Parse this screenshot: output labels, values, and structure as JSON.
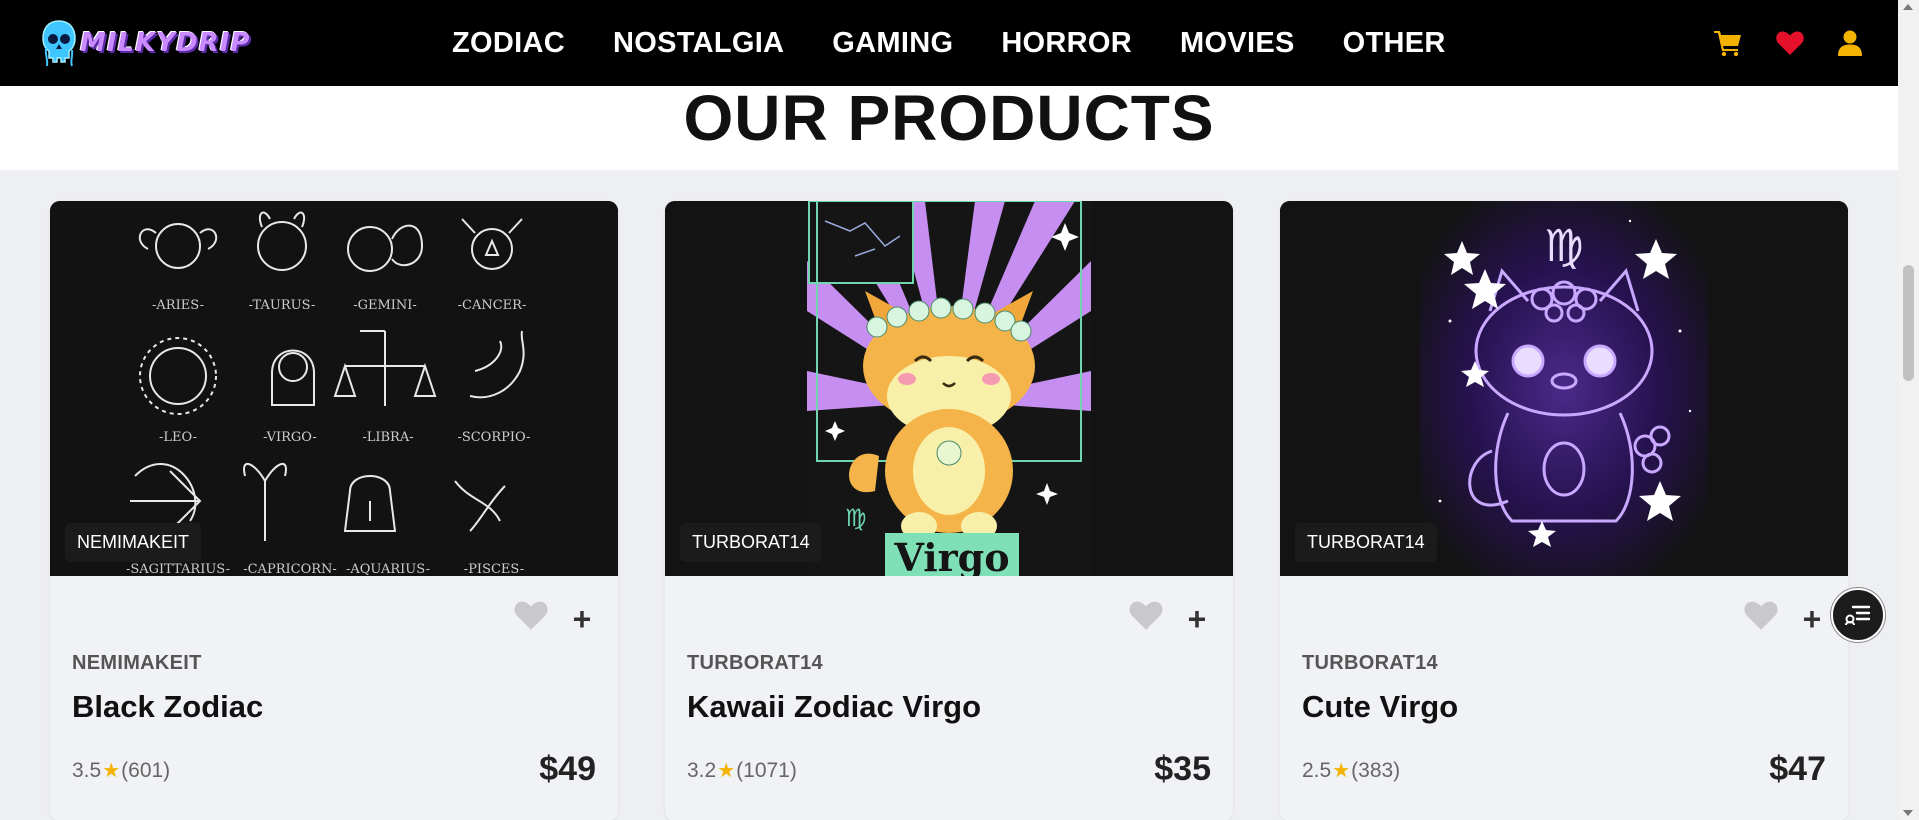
{
  "brand": {
    "logo_text": "MILKYDRIP"
  },
  "nav": {
    "links": [
      "ZODIAC",
      "NOSTALGIA",
      "GAMING",
      "HORROR",
      "MOVIES",
      "OTHER"
    ],
    "icons": [
      "cart-icon",
      "heart-icon",
      "user-icon"
    ]
  },
  "section": {
    "title": "OUR PRODUCTS"
  },
  "products": [
    {
      "tag": "NEMIMAKEIT",
      "seller": "NEMIMAKEIT",
      "name": "Black Zodiac",
      "rating": "3.5",
      "reviews": "(601)",
      "price": "$49"
    },
    {
      "tag": "TURBORAT14",
      "seller": "TURBORAT14",
      "name": "Kawaii Zodiac Virgo",
      "rating": "3.2",
      "reviews": "(1071)",
      "price": "$35"
    },
    {
      "tag": "TURBORAT14",
      "seller": "TURBORAT14",
      "name": "Cute Virgo",
      "rating": "2.5",
      "reviews": "(383)",
      "price": "$47"
    }
  ],
  "zodiac_labels": [
    "-ARIES-",
    "-TAURUS-",
    "-GEMINI-",
    "-CANCER-",
    "-LEO-",
    "-VIRGO-",
    "-LIBRA-",
    "-SCORPIO-",
    "-SAGITTARIUS-",
    "-CAPRICORN-",
    "-AQUARIUS-",
    "-PISCES-"
  ],
  "art_text": {
    "virgo_banner": "Virgo",
    "virgo_symbol": "♍"
  },
  "colors": {
    "nav_bg": "#000000",
    "accent_yellow": "#f5b301",
    "heart_red": "#e5102a",
    "card_bg": "#f1f2f5"
  }
}
